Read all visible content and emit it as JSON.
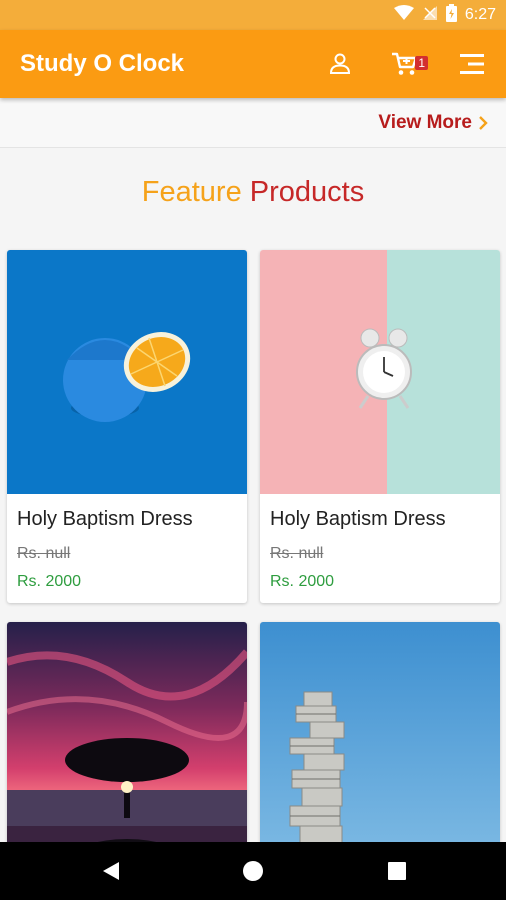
{
  "status_bar": {
    "time": "6:27"
  },
  "app_bar": {
    "title": "Study O Clock",
    "cart_count": "1"
  },
  "view_more": {
    "label": "View More"
  },
  "section": {
    "title_part1": "Feature",
    "title_part2": "Products"
  },
  "products": [
    {
      "name": "Holy Baptism Dress",
      "old_price": "Rs. null",
      "price": "Rs. 2000",
      "image": "orange-on-blue"
    },
    {
      "name": "Holy Baptism Dress",
      "old_price": "Rs. null",
      "price": "Rs. 2000",
      "image": "alarm-clock-pastel"
    },
    {
      "name": "",
      "old_price": "",
      "price": "",
      "image": "tree-sunset"
    },
    {
      "name": "",
      "old_price": "",
      "price": "",
      "image": "tower-sky"
    }
  ],
  "colors": {
    "status_bar": "#f4ad3a",
    "app_bar": "#fb9b12",
    "accent_red": "#c62828",
    "price_green": "#2e9d3f"
  }
}
